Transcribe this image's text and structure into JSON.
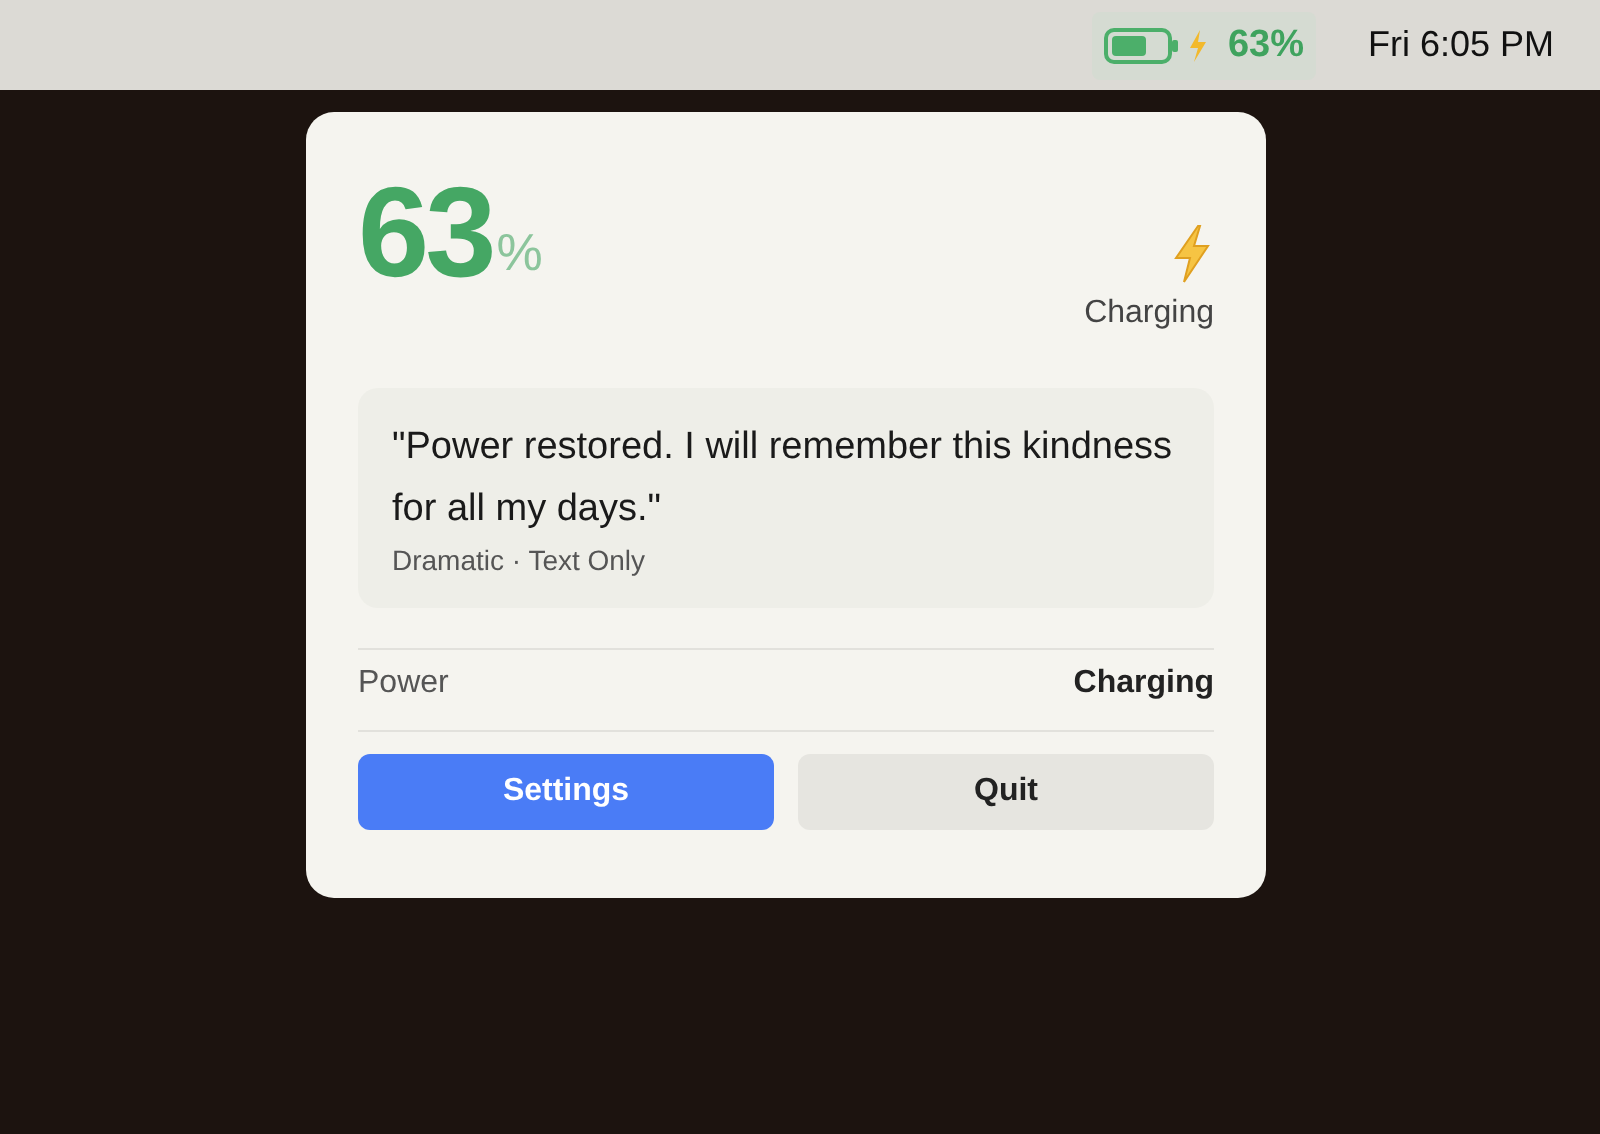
{
  "menu_bar": {
    "charging": true,
    "battery_percent": "63%",
    "clock": "Fri 6:05 PM"
  },
  "panel": {
    "percent_value": "63",
    "percent_sign": "%",
    "charging": true,
    "status": "Charging",
    "message": {
      "quote": "\"Power restored. I will remember this kindness for all my days.\"",
      "meta": "Dramatic · Text Only"
    },
    "info_rows": [
      {
        "label": "Power",
        "value": "Charging"
      }
    ],
    "buttons": [
      {
        "label": "Settings",
        "kind": "primary"
      },
      {
        "label": "Quit",
        "kind": "secondary"
      }
    ]
  }
}
